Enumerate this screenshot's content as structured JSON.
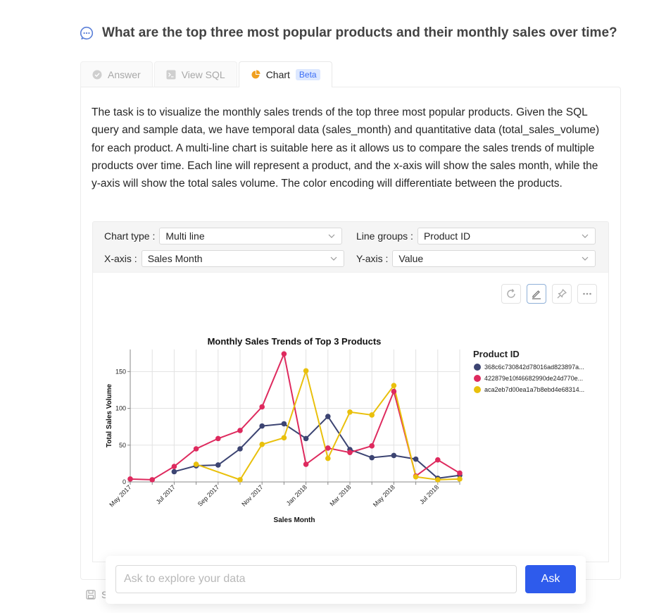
{
  "question": "What are the top three most popular products and their monthly sales over time?",
  "tabs": {
    "answer": "Answer",
    "view_sql": "View SQL",
    "chart": "Chart",
    "beta": "Beta"
  },
  "description": "The task is to visualize the monthly sales trends of the top three most popular products. Given the SQL query and sample data, we have temporal data (sales_month) and quantitative data (total_sales_volume) for each product. A multi-line chart is suitable here as it allows us to compare the sales trends of multiple products over time. Each line will represent a product, and the x-axis will show the sales month, while the y-axis will show the total sales volume. The color encoding will differentiate between the products.",
  "controls": {
    "chart_type_label": "Chart type :",
    "chart_type_value": "Multi line",
    "line_groups_label": "Line groups :",
    "line_groups_value": "Product ID",
    "x_axis_label": "X-axis :",
    "x_axis_value": "Sales Month",
    "y_axis_label": "Y-axis :",
    "y_axis_value": "Value"
  },
  "toolbar": {
    "icons": [
      "refresh-icon",
      "edit-icon",
      "pin-icon",
      "more-icon"
    ]
  },
  "ask": {
    "placeholder": "Ask to explore your data",
    "button": "Ask"
  },
  "save_fragment": "S",
  "colors": {
    "accent": "#2e5bec",
    "series_1": "#3c4472",
    "series_2": "#de2a5e",
    "series_3": "#e9c00c"
  },
  "chart_data": {
    "type": "line",
    "title": "Monthly Sales Trends of Top 3 Products",
    "xlabel": "Sales Month",
    "ylabel": "Total Sales Volume",
    "legend_title": "Product ID",
    "legend_position": "right",
    "grid": true,
    "ylim": [
      0,
      180
    ],
    "y_ticks": [
      0,
      50,
      100,
      150
    ],
    "x": [
      "May 2017",
      "Jun 2017",
      "Jul 2017",
      "Aug 2017",
      "Sep 2017",
      "Oct 2017",
      "Nov 2017",
      "Dec 2017",
      "Jan 2018",
      "Feb 2018",
      "Mar 2018",
      "Apr 2018",
      "May 2018",
      "Jun 2018",
      "Jul 2018",
      "Aug 2018"
    ],
    "x_tick_labels": [
      "May 2017",
      "Jul 2017",
      "Sep 2017",
      "Nov 2017",
      "Jan 2018",
      "Mar 2018",
      "May 2018",
      "Jul 2018"
    ],
    "series": [
      {
        "name": "368c6c730842d78016ad823897a...",
        "color": "#3c4472",
        "values": [
          null,
          null,
          14,
          22,
          23,
          45,
          76,
          79,
          59,
          89,
          44,
          33,
          36,
          31,
          5,
          9
        ]
      },
      {
        "name": "422879e10f46682990de24d770e...",
        "color": "#de2a5e",
        "values": [
          4,
          3,
          21,
          45,
          59,
          70,
          102,
          174,
          24,
          46,
          40,
          49,
          123,
          8,
          30,
          12
        ]
      },
      {
        "name": "aca2eb7d00ea1a7b8ebd4e68314...",
        "color": "#e9c00c",
        "values": [
          null,
          null,
          null,
          24,
          null,
          3,
          51,
          60,
          151,
          32,
          95,
          91,
          131,
          7,
          3,
          4
        ]
      }
    ]
  }
}
